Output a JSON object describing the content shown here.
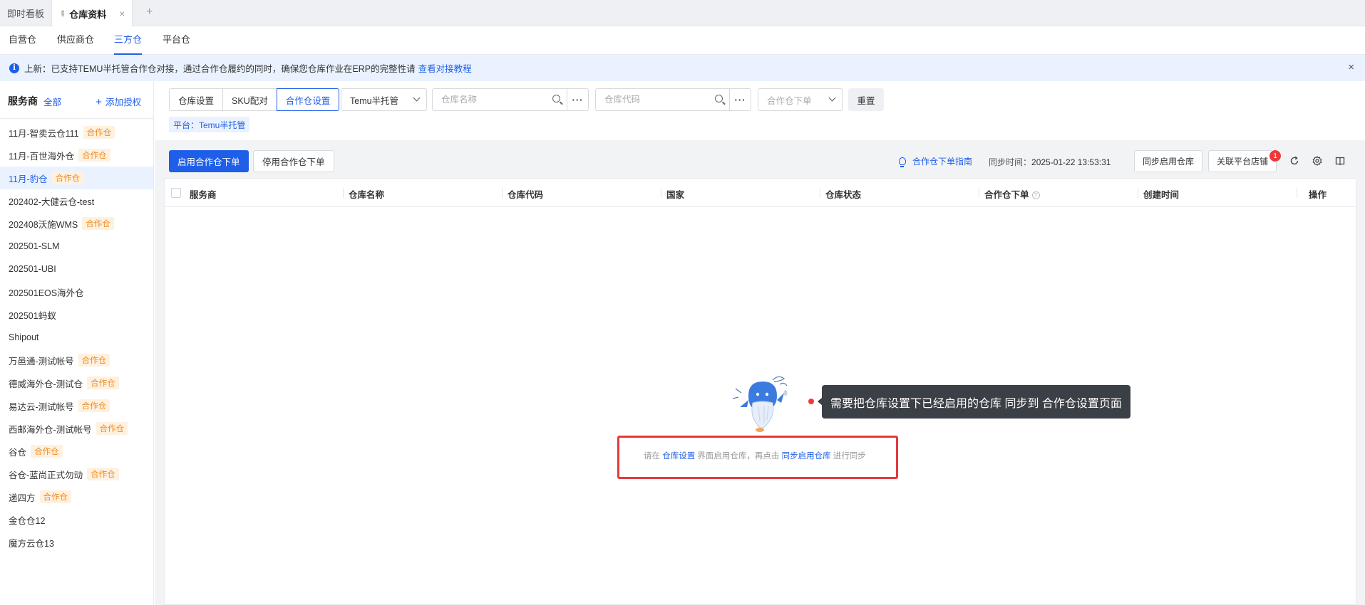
{
  "tabbar": {
    "tabs": [
      {
        "label": "即时看板",
        "active": false
      },
      {
        "label": "仓库资料",
        "active": true
      }
    ],
    "close_icon": "×",
    "add_icon": "+"
  },
  "subtabs": [
    {
      "label": "自营仓",
      "active": false
    },
    {
      "label": "供应商仓",
      "active": false
    },
    {
      "label": "三方仓",
      "active": true
    },
    {
      "label": "平台仓",
      "active": false
    }
  ],
  "notice": {
    "text": "上新：已支持TEMU半托管合作仓对接，通过合作仓履约的同时，确保您仓库作业在ERP的完整性请",
    "link": "查看对接教程",
    "close": "×"
  },
  "sidebar": {
    "title": "服务商",
    "all_label": "全部",
    "add_label": "添加授权",
    "tag_label": "合作仓",
    "items": [
      {
        "label": "11月-智卖云仓111",
        "tag": true,
        "active": false
      },
      {
        "label": "11月-百世海外仓",
        "tag": true,
        "active": false
      },
      {
        "label": "11月-豹仓",
        "tag": true,
        "active": true
      },
      {
        "label": "202402-大健云仓-test",
        "tag": false,
        "active": false
      },
      {
        "label": "202408沃施WMS",
        "tag": true,
        "active": false
      },
      {
        "label": "202501-SLM",
        "tag": false,
        "active": false
      },
      {
        "label": "202501-UBI",
        "tag": false,
        "active": false
      },
      {
        "label": "202501EOS海外仓",
        "tag": false,
        "active": false
      },
      {
        "label": "202501蚂蚁",
        "tag": false,
        "active": false
      },
      {
        "label": "Shipout",
        "tag": false,
        "active": false
      },
      {
        "label": "万邑通-测试帐号",
        "tag": true,
        "active": false
      },
      {
        "label": "德威海外仓-测试仓",
        "tag": true,
        "active": false
      },
      {
        "label": "易达云-测试帐号",
        "tag": true,
        "active": false
      },
      {
        "label": "西邮海外仓-测试帐号",
        "tag": true,
        "active": false
      },
      {
        "label": "谷仓",
        "tag": true,
        "active": false
      },
      {
        "label": "谷仓-蓝尚正式勿动",
        "tag": true,
        "active": false
      },
      {
        "label": "递四方",
        "tag": true,
        "active": false
      },
      {
        "label": "金仓仓12",
        "tag": false,
        "active": false
      },
      {
        "label": "魔方云仓13",
        "tag": false,
        "active": false
      }
    ]
  },
  "filters": {
    "segments": [
      {
        "label": "仓库设置",
        "active": false
      },
      {
        "label": "SKU配对",
        "active": false
      },
      {
        "label": "合作仓设置",
        "active": true
      }
    ],
    "platform_select": "Temu半托管",
    "name_placeholder": "仓库名称",
    "code_placeholder": "仓库代码",
    "order_select_placeholder": "合作仓下单",
    "reset_label": "重置",
    "more_label": "···",
    "platform_chip": "平台：Temu半托管"
  },
  "toolbar": {
    "enable_label": "启用合作仓下单",
    "disable_label": "停用合作仓下单",
    "guide_label": "合作仓下单指南",
    "sync_time_label": "同步时间：",
    "sync_time_value": "2025-01-22 13:53:31",
    "sync_button": "同步启用仓库",
    "link_button": "关联平台店铺",
    "badge_count": "1"
  },
  "table": {
    "columns": [
      "服务商",
      "仓库名称",
      "仓库代码",
      "国家",
      "仓库状态",
      "合作仓下单",
      "创建时间",
      "操作"
    ],
    "rows": []
  },
  "empty_state": {
    "tooltip": "需要把仓库设置下已经启用的仓库 同步到 合作仓设置页面",
    "text_1": "请在 ",
    "link_1": "仓库设置",
    "text_2": " 界面启用仓库，再点击 ",
    "link_2": "同步启用仓库",
    "text_3": " 进行同步"
  },
  "colors": {
    "primary": "#1f5ee8",
    "tag_text": "#f08a1c",
    "tag_bg": "#fff1e0",
    "highlight_border": "#e5393a",
    "tooltip_bg": "#3b3f46",
    "badge": "#ee3a3a"
  },
  "icons": {
    "pin": "pin-icon",
    "info": "info-icon",
    "search": "search-icon",
    "chevron": "chevron-down-icon",
    "bulb": "lightbulb-icon",
    "refresh": "refresh-icon",
    "settings": "gear-icon",
    "book": "book-icon",
    "mascot": "whale-mascot-icon"
  }
}
